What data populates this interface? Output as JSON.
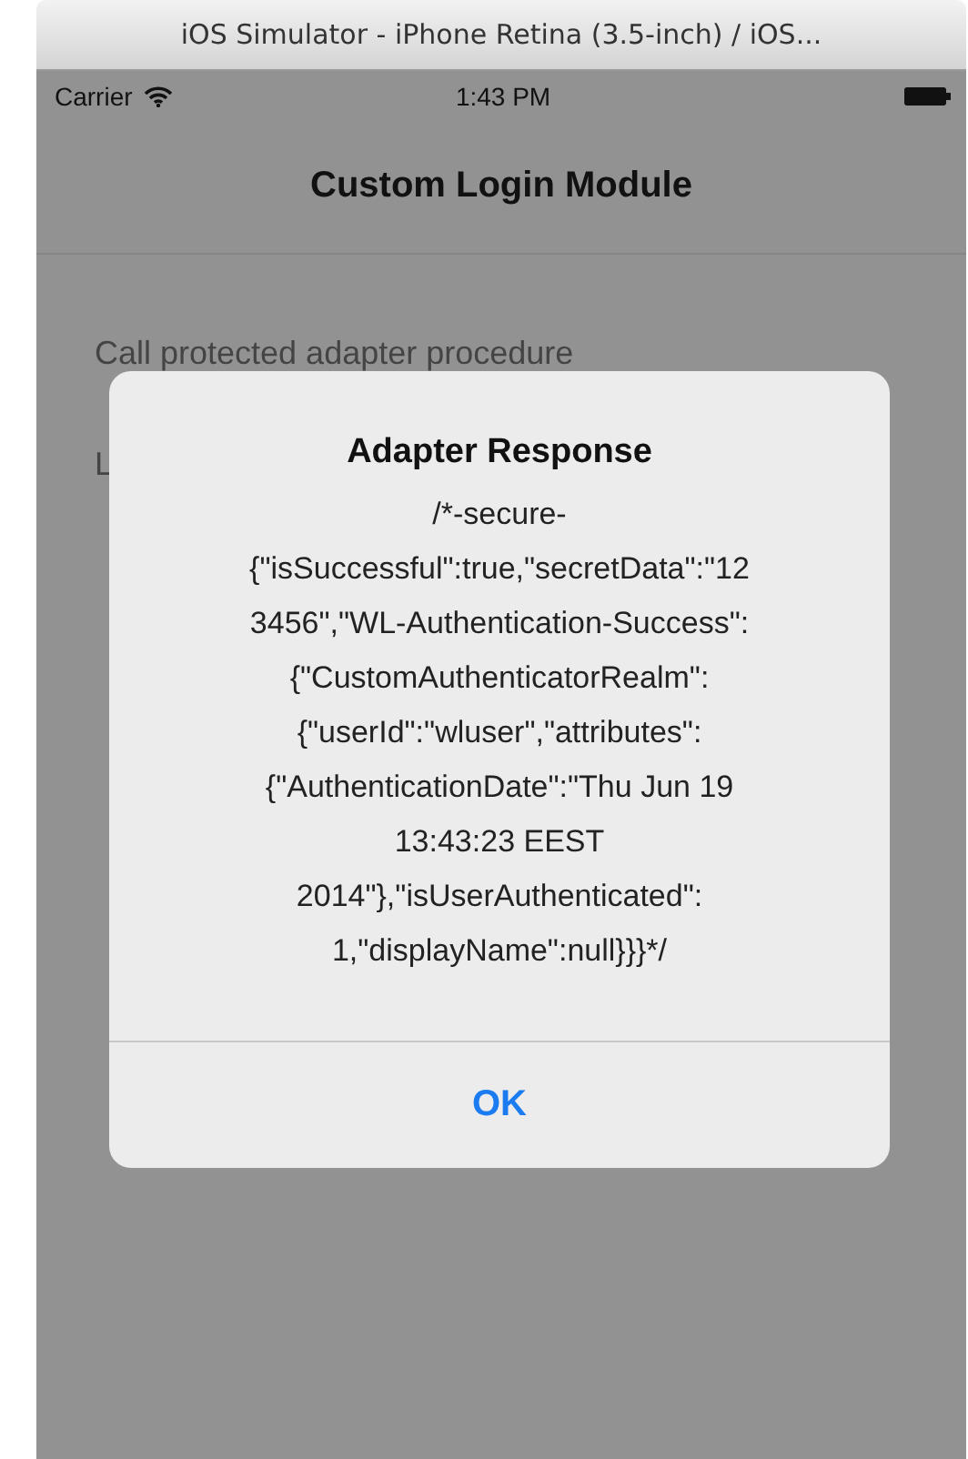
{
  "window": {
    "title": "iOS Simulator - iPhone Retina (3.5-inch) / iOS..."
  },
  "status_bar": {
    "carrier": "Carrier",
    "time": "1:43 PM"
  },
  "nav_bar": {
    "title": "Custom Login Module"
  },
  "list_items": [
    {
      "label": "Call protected adapter procedure"
    },
    {
      "label": "L"
    }
  ],
  "alert": {
    "title": "Adapter Response",
    "message_lines": [
      "/*-secure-",
      "{\"isSuccessful\":true,\"secretData\":\"12",
      "3456\",\"WL-Authentication-Success\":",
      "{\"CustomAuthenticatorRealm\":",
      "{\"userId\":\"wluser\",\"attributes\":",
      "{\"AuthenticationDate\":\"Thu Jun 19",
      "13:43:23 EEST",
      "2014\"},\"isUserAuthenticated\":",
      "1,\"displayName\":null}}}*/"
    ],
    "button": "OK"
  }
}
